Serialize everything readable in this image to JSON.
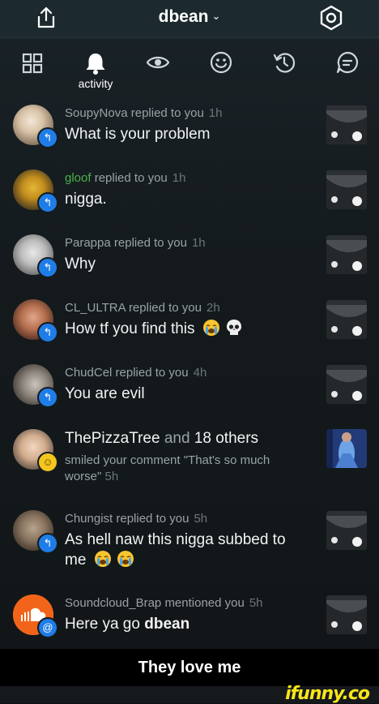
{
  "header": {
    "title": "dbean"
  },
  "tabs": {
    "active_label": "activity"
  },
  "notifications": [
    {
      "name": "SoupyNova",
      "action": "replied to you",
      "time": "1h",
      "message": "What is your problem"
    },
    {
      "name": "gloof",
      "action": "replied to you",
      "time": "1h",
      "message": "nigga."
    },
    {
      "name": "Parappa",
      "action": "replied to you",
      "time": "1h",
      "message": "Why"
    },
    {
      "name": "CL_ULTRA",
      "action": "replied to you",
      "time": "2h",
      "message": "How tf you find this"
    },
    {
      "name": "ChudCel",
      "action": "replied to you",
      "time": "4h",
      "message": "You are evil"
    },
    {
      "name": "ThePizzaTree",
      "and": "and",
      "others": "18 others",
      "detail": "smiled your comment \"That's so much worse\"",
      "time": "5h"
    },
    {
      "name": "Chungist",
      "action": "replied to you",
      "time": "5h",
      "message": "As hell naw this nigga subbed to me"
    },
    {
      "name": "Soundcloud_Brap",
      "action": "mentioned you",
      "time": "5h",
      "message": "Here ya go",
      "mention": "dbean"
    }
  ],
  "caption": "They love me",
  "watermark": "ifunny.co",
  "colors": {
    "accent": "#1f7de8",
    "green_name": "#49b24a",
    "smile_badge": "#f4c61e"
  }
}
